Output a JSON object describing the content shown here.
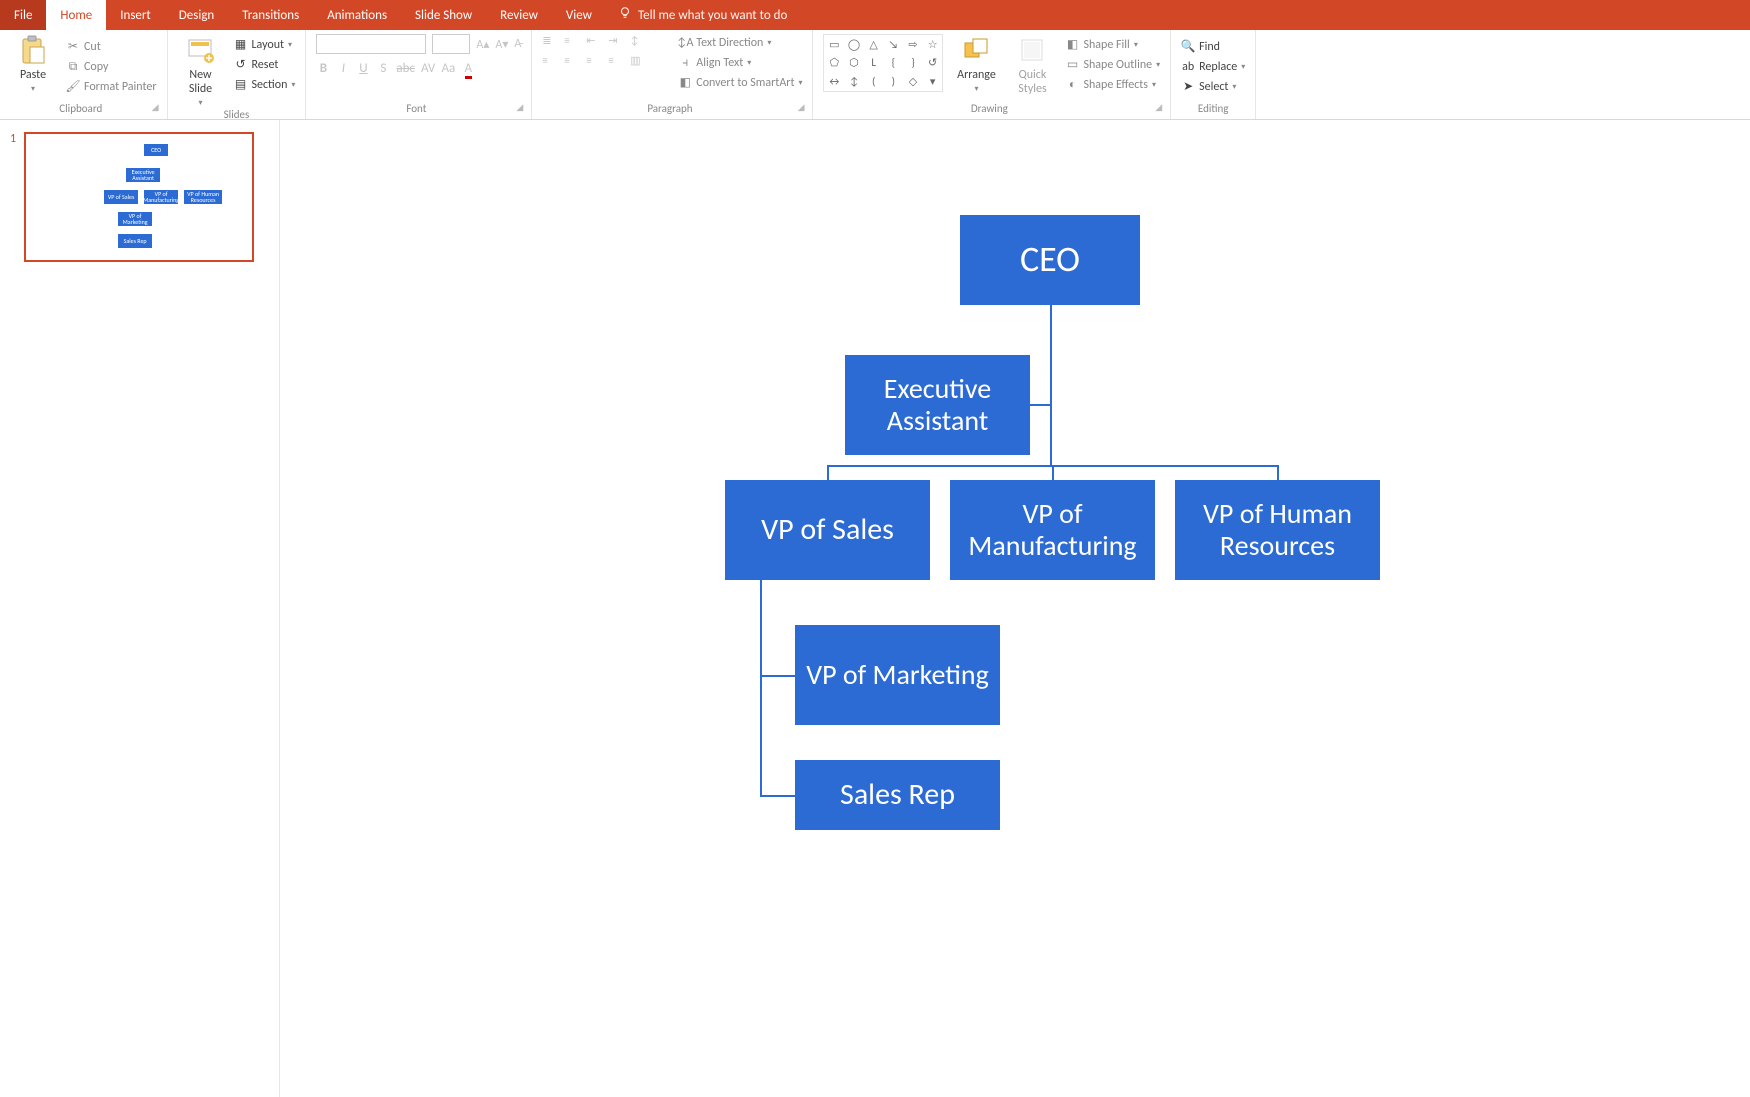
{
  "tabs": {
    "file": "File",
    "home": "Home",
    "insert": "Insert",
    "design": "Design",
    "transitions": "Transitions",
    "animations": "Animations",
    "slideshow": "Slide Show",
    "review": "Review",
    "view": "View",
    "tellme": "Tell me what you want to do"
  },
  "ribbon": {
    "clipboard": {
      "paste": "Paste",
      "cut": "Cut",
      "copy": "Copy",
      "format_painter": "Format Painter",
      "label": "Clipboard"
    },
    "slides": {
      "new_slide": "New\nSlide",
      "layout": "Layout",
      "reset": "Reset",
      "section": "Section",
      "label": "Slides"
    },
    "font": {
      "label": "Font"
    },
    "paragraph": {
      "text_direction": "Text Direction",
      "align_text": "Align Text",
      "convert": "Convert to SmartArt",
      "label": "Paragraph"
    },
    "drawing": {
      "arrange": "Arrange",
      "quick_styles": "Quick\nStyles",
      "shape_fill": "Shape Fill",
      "shape_outline": "Shape Outline",
      "shape_effects": "Shape Effects",
      "label": "Drawing"
    },
    "editing": {
      "find": "Find",
      "replace": "Replace",
      "select": "Select",
      "label": "Editing"
    }
  },
  "thumb": {
    "number": "1"
  },
  "chart_data": {
    "type": "org-chart",
    "nodes": [
      {
        "id": "ceo",
        "label": "CEO",
        "parent": null
      },
      {
        "id": "ea",
        "label": "Executive Assistant",
        "parent": "ceo",
        "assistant": true
      },
      {
        "id": "vps",
        "label": "VP of Sales",
        "parent": "ceo"
      },
      {
        "id": "vpm",
        "label": "VP of Manufacturing",
        "parent": "ceo"
      },
      {
        "id": "vph",
        "label": "VP of Human Resources",
        "parent": "ceo"
      },
      {
        "id": "vmk",
        "label": "VP of Marketing",
        "parent": "vps"
      },
      {
        "id": "rep",
        "label": "Sales Rep",
        "parent": "vps"
      }
    ]
  }
}
